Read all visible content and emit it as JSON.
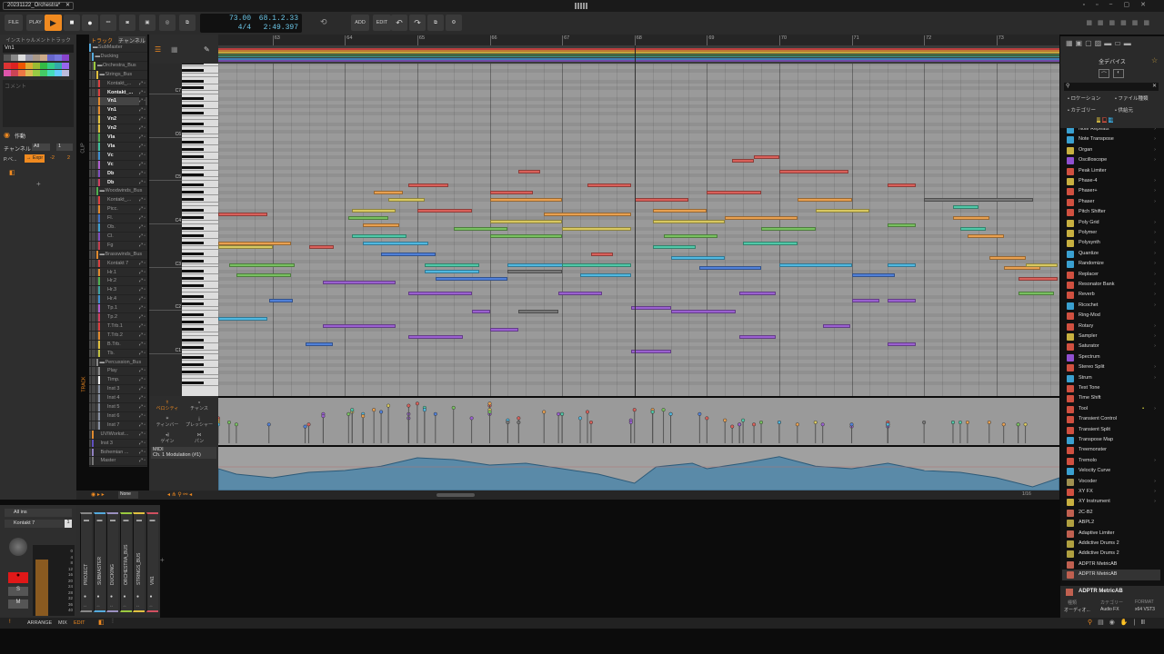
{
  "window": {
    "tab_title": "20231122_Orchestra*"
  },
  "toolbar": {
    "file": "FILE",
    "play": "PLAY",
    "tempo": "73.00",
    "time_sig": "4/4",
    "position": "68.1.2.33",
    "time": "2:49.397",
    "add": "ADD",
    "edit": "EDIT"
  },
  "inspector": {
    "header": "インストゥルメントトラック",
    "track_name": "Vn1",
    "comment_placeholder": "コメント",
    "active_label": "作動",
    "channel_label": "チャンネル",
    "channel_value": "All",
    "channel_num": "1",
    "pexpr_label": "P.ベ...",
    "expr_button": "→ Expr",
    "range_low": "-2",
    "range_high": "2",
    "add": "+"
  },
  "swatches": [
    "#555",
    "#888",
    "#ddd",
    "#99a",
    "#a98",
    "#ca8",
    "#66c",
    "#77d",
    "#84c",
    "#d33",
    "#d22",
    "#e50",
    "#da3",
    "#9b3",
    "#3b4",
    "#3c8",
    "#3aa",
    "#96e",
    "#d5a",
    "#c45",
    "#e74",
    "#db5",
    "#9c4",
    "#4c6",
    "#4db",
    "#6cf",
    "#bbd"
  ],
  "tracks_panel": {
    "tab_track": "トラック",
    "tab_channel": "チャンネル",
    "clip_label": "CLIP",
    "track_label": "TRACK"
  },
  "tracks": [
    {
      "name": "SubMaster",
      "lvl": 0,
      "group": true,
      "color": "#55aadd"
    },
    {
      "name": "Ducking",
      "lvl": 1,
      "group": true,
      "color": "#55aadd"
    },
    {
      "name": "Orchestra_Bus",
      "lvl": 2,
      "group": true,
      "color": "#9bc93f"
    },
    {
      "name": "Strings_Bus",
      "lvl": 3,
      "group": true,
      "color": "#e0c040"
    },
    {
      "name": "Kontakt_...",
      "lvl": 4,
      "color": "#d94040"
    },
    {
      "name": "Kontakt_...",
      "lvl": 4,
      "color": "#d94040",
      "bold": true
    },
    {
      "name": "Vn1",
      "lvl": 4,
      "color": "#e08a30",
      "bold": true,
      "selected": true
    },
    {
      "name": "Vn1",
      "lvl": 4,
      "color": "#e08a30",
      "bold": true
    },
    {
      "name": "Vn2",
      "lvl": 4,
      "color": "#e0c040",
      "bold": true
    },
    {
      "name": "Vn2",
      "lvl": 4,
      "color": "#e0c040",
      "bold": true
    },
    {
      "name": "Vla",
      "lvl": 4,
      "color": "#50b050",
      "bold": true
    },
    {
      "name": "Vla",
      "lvl": 4,
      "color": "#40c0a0",
      "bold": true
    },
    {
      "name": "Vc",
      "lvl": 4,
      "color": "#4090d0",
      "bold": true
    },
    {
      "name": "Vc",
      "lvl": 4,
      "color": "#b060d0",
      "bold": true
    },
    {
      "name": "Db",
      "lvl": 4,
      "color": "#8050c0",
      "bold": true
    },
    {
      "name": "Db",
      "lvl": 4,
      "color": "#d04060",
      "bold": true
    },
    {
      "name": "Woodwinds_Bus",
      "lvl": 3,
      "group": true,
      "color": "#50b050"
    },
    {
      "name": "Kontakt_...",
      "lvl": 4,
      "color": "#d94040"
    },
    {
      "name": "Picc.",
      "lvl": 4,
      "color": "#e08a30"
    },
    {
      "name": "Fl.",
      "lvl": 4,
      "color": "#4070c0"
    },
    {
      "name": "Ob.",
      "lvl": 4,
      "color": "#40a0d0"
    },
    {
      "name": "Cl.",
      "lvl": 4,
      "color": "#8050c0"
    },
    {
      "name": "Fg",
      "lvl": 4,
      "color": "#c04050"
    },
    {
      "name": "Brasswinds_Bus",
      "lvl": 3,
      "group": true,
      "color": "#e08a30"
    },
    {
      "name": "Kontakt 7",
      "lvl": 4,
      "color": "#d94040"
    },
    {
      "name": "Hr.1",
      "lvl": 4,
      "color": "#e08a30"
    },
    {
      "name": "Hr.2",
      "lvl": 4,
      "color": "#50b050"
    },
    {
      "name": "Hr.3",
      "lvl": 4,
      "color": "#40a0a0"
    },
    {
      "name": "Hr.4",
      "lvl": 4,
      "color": "#4090d0"
    },
    {
      "name": "Tp.1",
      "lvl": 4,
      "color": "#b060d0"
    },
    {
      "name": "Tp.2",
      "lvl": 4,
      "color": "#d04060"
    },
    {
      "name": "T.Trb.1",
      "lvl": 4,
      "color": "#d94040"
    },
    {
      "name": "T.Trb.2",
      "lvl": 4,
      "color": "#e08a30"
    },
    {
      "name": "B.Trb.",
      "lvl": 4,
      "color": "#e0c040"
    },
    {
      "name": "Tb.",
      "lvl": 4,
      "color": "#c0c040"
    },
    {
      "name": "Percussion_Bus",
      "lvl": 3,
      "group": true,
      "color": "#888"
    },
    {
      "name": "Play",
      "lvl": 4,
      "color": "#888"
    },
    {
      "name": "Timp.",
      "lvl": 4,
      "color": "#eee"
    },
    {
      "name": "Inst 3",
      "lvl": 4,
      "color": "#8890a0"
    },
    {
      "name": "Inst 4",
      "lvl": 4,
      "color": "#8890a0"
    },
    {
      "name": "Inst 5",
      "lvl": 4,
      "color": "#8890a0"
    },
    {
      "name": "Inst 6",
      "lvl": 4,
      "color": "#8890a0"
    },
    {
      "name": "Inst 7",
      "lvl": 4,
      "color": "#8890a0"
    },
    {
      "name": "UVIWorkst...",
      "lvl": 1,
      "color": "#e08a30"
    },
    {
      "name": "Inst 3",
      "lvl": 1,
      "color": "#6050c0"
    },
    {
      "name": "Bohemian ...",
      "lvl": 1,
      "color": "#9080c0"
    },
    {
      "name": "Master",
      "lvl": 1,
      "color": "#777"
    }
  ],
  "ruler": {
    "bars": [
      "63",
      "64",
      "65",
      "66",
      "67",
      "68",
      "69",
      "70",
      "71",
      "72",
      "73"
    ]
  },
  "key_labels": [
    "C7",
    "C6",
    "C5",
    "C4",
    "C3",
    "C2",
    "C1"
  ],
  "lanes": {
    "velocity": "ベロシティ",
    "chance": "チャンス",
    "timbre": "ティンバー",
    "pressure": "プレッシャー",
    "gain": "ゲイン",
    "pan": "パン",
    "midi": "MIDI",
    "cc": "Ch. 1 Modulation (#1)"
  },
  "editor_footer": {
    "scale": "None",
    "grid": "1/16"
  },
  "chart_data": {
    "type": "piano-roll",
    "bar_range": [
      62.25,
      73.87
    ],
    "pitch_ref": "C4 label = 60",
    "playhead_bar": 68.0,
    "palette": [
      "#d9605a",
      "#e8a050",
      "#d8c860",
      "#78c060",
      "#50c8a8",
      "#50b8e0",
      "#5080d8",
      "#9a60d0",
      "#d060a0",
      "#777777"
    ],
    "notes_fields": [
      "start_bar",
      "pitch",
      "length_bars",
      "color",
      "velocity"
    ],
    "notes": [
      [
        62.25,
        62,
        0.68,
        0,
        0.6
      ],
      [
        62.25,
        54,
        1.0,
        1,
        0.55
      ],
      [
        62.25,
        53,
        0.75,
        2,
        0.5
      ],
      [
        62.25,
        33,
        0.68,
        5,
        0.45
      ],
      [
        62.4,
        48,
        0.9,
        3,
        0.5
      ],
      [
        62.5,
        45,
        0.75,
        3,
        0.45
      ],
      [
        62.95,
        38,
        0.33,
        6,
        0.45
      ],
      [
        63.5,
        53,
        0.35,
        0,
        0.45
      ],
      [
        63.45,
        26,
        0.38,
        6,
        0.4
      ],
      [
        63.7,
        43,
        1.0,
        7,
        0.7
      ],
      [
        63.7,
        31,
        1.0,
        7,
        0.65
      ],
      [
        64.88,
        28,
        0.75,
        7,
        0.6
      ],
      [
        64.88,
        40,
        0.88,
        7,
        0.7
      ],
      [
        64.88,
        70,
        0.55,
        0,
        0.9
      ],
      [
        64.4,
        68,
        0.4,
        1,
        0.8
      ],
      [
        64.1,
        63,
        0.6,
        2,
        0.75
      ],
      [
        64.05,
        61,
        0.55,
        3,
        0.7
      ],
      [
        64.1,
        56,
        0.75,
        4,
        0.8
      ],
      [
        64.25,
        54,
        0.9,
        5,
        0.7
      ],
      [
        64.5,
        51,
        0.75,
        6,
        0.75
      ],
      [
        64.25,
        59,
        0.5,
        1,
        0.65
      ],
      [
        64.6,
        66,
        0.5,
        2,
        0.9
      ],
      [
        65.0,
        63,
        0.75,
        0,
        0.95
      ],
      [
        65.1,
        48,
        0.75,
        4,
        0.85
      ],
      [
        65.1,
        46,
        0.75,
        5,
        0.8
      ],
      [
        65.25,
        44,
        1.0,
        6,
        0.7
      ],
      [
        65.5,
        58,
        0.75,
        3,
        0.85
      ],
      [
        65.75,
        35,
        0.25,
        7,
        0.6
      ],
      [
        66.0,
        30,
        0.4,
        7,
        0.7
      ],
      [
        66.0,
        68,
        0.6,
        0,
        0.9
      ],
      [
        66.0,
        66,
        1.0,
        1,
        0.95
      ],
      [
        66.0,
        60,
        1.0,
        2,
        0.8
      ],
      [
        66.0,
        56,
        1.0,
        3,
        0.75
      ],
      [
        66.25,
        48,
        1.0,
        5,
        0.55
      ],
      [
        66.4,
        74,
        0.3,
        0,
        0.6
      ],
      [
        66.4,
        35,
        0.55,
        9,
        0.5
      ],
      [
        66.25,
        46,
        0.75,
        9,
        0.5
      ],
      [
        66.75,
        62,
        1.2,
        1,
        0.75
      ],
      [
        67.0,
        58,
        0.95,
        2,
        0.7
      ],
      [
        66.95,
        40,
        0.6,
        7,
        0.7
      ],
      [
        67.4,
        51,
        0.3,
        0,
        0.5
      ],
      [
        67.35,
        70,
        0.6,
        0,
        0.75
      ],
      [
        67.0,
        48,
        0.95,
        4,
        0.7
      ],
      [
        67.25,
        45,
        0.7,
        5,
        0.6
      ],
      [
        67.95,
        36,
        0.55,
        7,
        0.55
      ],
      [
        67.95,
        24,
        0.55,
        7,
        0.5
      ],
      [
        68.5,
        35,
        0.9,
        7,
        0.7
      ],
      [
        68.0,
        66,
        0.75,
        0,
        0.8
      ],
      [
        68.25,
        63,
        0.75,
        1,
        0.8
      ],
      [
        68.25,
        60,
        1.0,
        2,
        0.75
      ],
      [
        68.4,
        56,
        0.75,
        3,
        0.8
      ],
      [
        68.25,
        53,
        0.6,
        4,
        0.75
      ],
      [
        68.5,
        50,
        0.75,
        5,
        0.7
      ],
      [
        68.9,
        47,
        0.85,
        6,
        0.7
      ],
      [
        69.0,
        68,
        0.75,
        0,
        0.6
      ],
      [
        69.35,
        77,
        0.3,
        0,
        0.4
      ],
      [
        69.65,
        78,
        0.35,
        0,
        0.45
      ],
      [
        70.0,
        74,
        0.95,
        0,
        0.5
      ],
      [
        69.25,
        61,
        1.0,
        1,
        0.55
      ],
      [
        69.75,
        58,
        0.75,
        3,
        0.5
      ],
      [
        69.5,
        54,
        0.75,
        4,
        0.55
      ],
      [
        70.0,
        48,
        1.0,
        5,
        0.5
      ],
      [
        70.25,
        66,
        0.75,
        1,
        0.45
      ],
      [
        70.5,
        63,
        0.75,
        2,
        0.5
      ],
      [
        69.45,
        40,
        0.5,
        7,
        0.45
      ],
      [
        69.45,
        28,
        0.5,
        7,
        0.45
      ],
      [
        70.6,
        31,
        0.38,
        7,
        0.45
      ],
      [
        71.0,
        38,
        0.38,
        7,
        0.4
      ],
      [
        71.5,
        38,
        0.38,
        7,
        0.45
      ],
      [
        71.5,
        26,
        0.38,
        7,
        0.4
      ],
      [
        71.5,
        70,
        0.38,
        0,
        0.5
      ],
      [
        71.5,
        59,
        0.38,
        3,
        0.45
      ],
      [
        71.5,
        48,
        0.38,
        5,
        0.45
      ],
      [
        71.0,
        45,
        0.6,
        6,
        0.45
      ],
      [
        72.0,
        66,
        1.5,
        9,
        0.5
      ],
      [
        72.4,
        61,
        0.5,
        1,
        0.5
      ],
      [
        72.6,
        56,
        0.5,
        1,
        0.5
      ],
      [
        72.9,
        50,
        0.5,
        1,
        0.5
      ],
      [
        73.1,
        47,
        0.5,
        1,
        0.45
      ],
      [
        73.3,
        44,
        0.55,
        0,
        0.45
      ],
      [
        73.3,
        40,
        0.5,
        3,
        0.45
      ],
      [
        72.4,
        64,
        0.35,
        4,
        0.5
      ],
      [
        72.5,
        58,
        0.35,
        4,
        0.5
      ],
      [
        73.4,
        48,
        0.45,
        2,
        0.45
      ]
    ],
    "modulation": [
      [
        62.25,
        0.55
      ],
      [
        62.5,
        0.4
      ],
      [
        63.0,
        0.3
      ],
      [
        63.5,
        0.45
      ],
      [
        64.0,
        0.5
      ],
      [
        64.5,
        0.62
      ],
      [
        65.0,
        0.85
      ],
      [
        65.5,
        0.8
      ],
      [
        66.0,
        0.65
      ],
      [
        66.5,
        0.7
      ],
      [
        67.0,
        0.55
      ],
      [
        67.5,
        0.4
      ],
      [
        68.0,
        0.15
      ],
      [
        68.3,
        0.6
      ],
      [
        68.8,
        0.7
      ],
      [
        69.0,
        0.55
      ],
      [
        69.5,
        0.7
      ],
      [
        70.0,
        0.88
      ],
      [
        70.5,
        0.62
      ],
      [
        71.0,
        0.55
      ],
      [
        71.5,
        0.7
      ],
      [
        72.0,
        0.5
      ],
      [
        72.5,
        0.45
      ],
      [
        73.0,
        0.3
      ],
      [
        73.5,
        0.05
      ],
      [
        73.87,
        0.3
      ]
    ]
  },
  "browser": {
    "title": "全デバイス",
    "search_placeholder": "",
    "filter_location": "ロケーション",
    "filter_filetype": "ファイル種類",
    "filter_category": "カテゴリー",
    "filter_creator": "供給元",
    "selected": {
      "name": "ADPTR MetricAB",
      "type_label": "種類",
      "type": "オーディオ...",
      "category_label": "カテゴリー",
      "category": "Audio FX",
      "format_label": "FORMAT",
      "format": "x64 VST3"
    },
    "devices": [
      {
        "n": "Note Repeats",
        "c": "#3aa0d0",
        "a": 1
      },
      {
        "n": "Note Transpose",
        "c": "#3aa0d0",
        "a": 1
      },
      {
        "n": "Organ",
        "c": "#c8b040",
        "a": 1
      },
      {
        "n": "Oscilloscope",
        "c": "#9050d0",
        "a": 1
      },
      {
        "n": "Peak Limiter",
        "c": "#d05040",
        "a": 0
      },
      {
        "n": "Phase-4",
        "c": "#c8b040",
        "a": 1
      },
      {
        "n": "Phaser+",
        "c": "#d05040",
        "a": 1
      },
      {
        "n": "Phaser",
        "c": "#d05040",
        "a": 1
      },
      {
        "n": "Pitch Shifter",
        "c": "#d05040",
        "a": 0
      },
      {
        "n": "Poly Grid",
        "c": "#c8b040",
        "a": 1
      },
      {
        "n": "Polymer",
        "c": "#c8b040",
        "a": 1
      },
      {
        "n": "Polysynth",
        "c": "#c8b040",
        "a": 1
      },
      {
        "n": "Quantize",
        "c": "#3aa0d0",
        "a": 1
      },
      {
        "n": "Randomize",
        "c": "#3aa0d0",
        "a": 1
      },
      {
        "n": "Replacer",
        "c": "#d05040",
        "a": 1
      },
      {
        "n": "Resonator Bank",
        "c": "#d05040",
        "a": 1
      },
      {
        "n": "Reverb",
        "c": "#d05040",
        "a": 1
      },
      {
        "n": "Ricochet",
        "c": "#3aa0d0",
        "a": 1
      },
      {
        "n": "Ring-Mod",
        "c": "#d05040",
        "a": 0
      },
      {
        "n": "Rotary",
        "c": "#d05040",
        "a": 1
      },
      {
        "n": "Sampler",
        "c": "#c8b040",
        "a": 1
      },
      {
        "n": "Saturator",
        "c": "#d05040",
        "a": 1
      },
      {
        "n": "Spectrum",
        "c": "#9050d0",
        "a": 0
      },
      {
        "n": "Stereo Split",
        "c": "#d05040",
        "a": 1
      },
      {
        "n": "Strum",
        "c": "#3aa0d0",
        "a": 1
      },
      {
        "n": "Test Tone",
        "c": "#d05040",
        "a": 0
      },
      {
        "n": "Time Shift",
        "c": "#d05040",
        "a": 0
      },
      {
        "n": "Tool",
        "c": "#d05040",
        "a": 1,
        "star": true
      },
      {
        "n": "Transient Control",
        "c": "#d05040",
        "a": 0
      },
      {
        "n": "Transient Split",
        "c": "#d05040",
        "a": 0
      },
      {
        "n": "Transpose Map",
        "c": "#3aa0d0",
        "a": 0
      },
      {
        "n": "Treemonster",
        "c": "#d05040",
        "a": 0
      },
      {
        "n": "Tremolo",
        "c": "#d05040",
        "a": 1
      },
      {
        "n": "Velocity Curve",
        "c": "#3aa0d0",
        "a": 0
      },
      {
        "n": "Vocoder",
        "c": "#a09050",
        "a": 1
      },
      {
        "n": "XY FX",
        "c": "#d05040",
        "a": 1
      },
      {
        "n": "XY Instrument",
        "c": "#c8b040",
        "a": 1
      },
      {
        "n": "2C-B2",
        "c": "#c06050",
        "a": 0
      },
      {
        "n": "ABPL2",
        "c": "#b0a040",
        "a": 0
      },
      {
        "n": "Adaptive Limiter",
        "c": "#c06050",
        "a": 0
      },
      {
        "n": "Addictive Drums 2",
        "c": "#b0a040",
        "a": 0
      },
      {
        "n": "Addictive Drums 2",
        "c": "#b0a040",
        "a": 0
      },
      {
        "n": "ADPTR MetricAB",
        "c": "#c06050",
        "a": 0
      },
      {
        "n": "ADPTR MetricAB",
        "c": "#c06050",
        "a": 0,
        "sel": true
      }
    ]
  },
  "mixer": {
    "input": "All ins",
    "instrument": "Kontakt 7",
    "instrument_num": "1",
    "rec": "●",
    "solo": "S",
    "mute": "M",
    "meter_scale": [
      "0",
      "4",
      "8",
      "12",
      "16",
      "20",
      "24",
      "28",
      "32",
      "36",
      "40"
    ],
    "strips": [
      {
        "n": "PROJECT",
        "c": "#888"
      },
      {
        "n": "SUBMASTER",
        "c": "#55aadd"
      },
      {
        "n": "DUCKING",
        "c": "#9a90c0"
      },
      {
        "n": "ORCHESTRA_BUS",
        "c": "#9bc93f"
      },
      {
        "n": "STRINGS_BUS",
        "c": "#e0c040"
      },
      {
        "n": "VN1",
        "c": "#d05060"
      }
    ],
    "add": "+"
  },
  "statusbar": {
    "arrange": "ARRANGE",
    "mix": "MIX",
    "edit": "EDIT"
  }
}
